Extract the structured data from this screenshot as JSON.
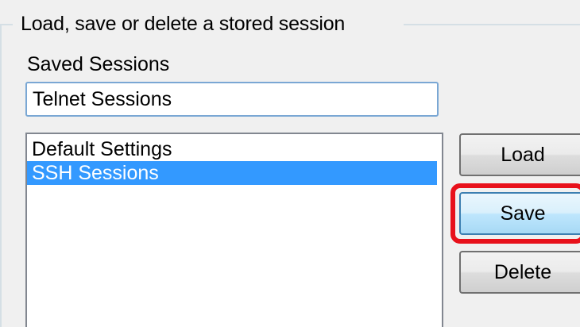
{
  "group": {
    "legend": "Load, save or delete a stored session"
  },
  "saved_sessions": {
    "label": "Saved Sessions",
    "input_value": "Telnet Sessions",
    "items": [
      {
        "label": "Default Settings",
        "selected": false
      },
      {
        "label": "SSH Sessions",
        "selected": true
      }
    ]
  },
  "buttons": {
    "load_label": "Load",
    "save_label": "Save",
    "delete_label": "Delete"
  },
  "colors": {
    "selection": "#3399ff",
    "highlight": "#e8111b"
  }
}
